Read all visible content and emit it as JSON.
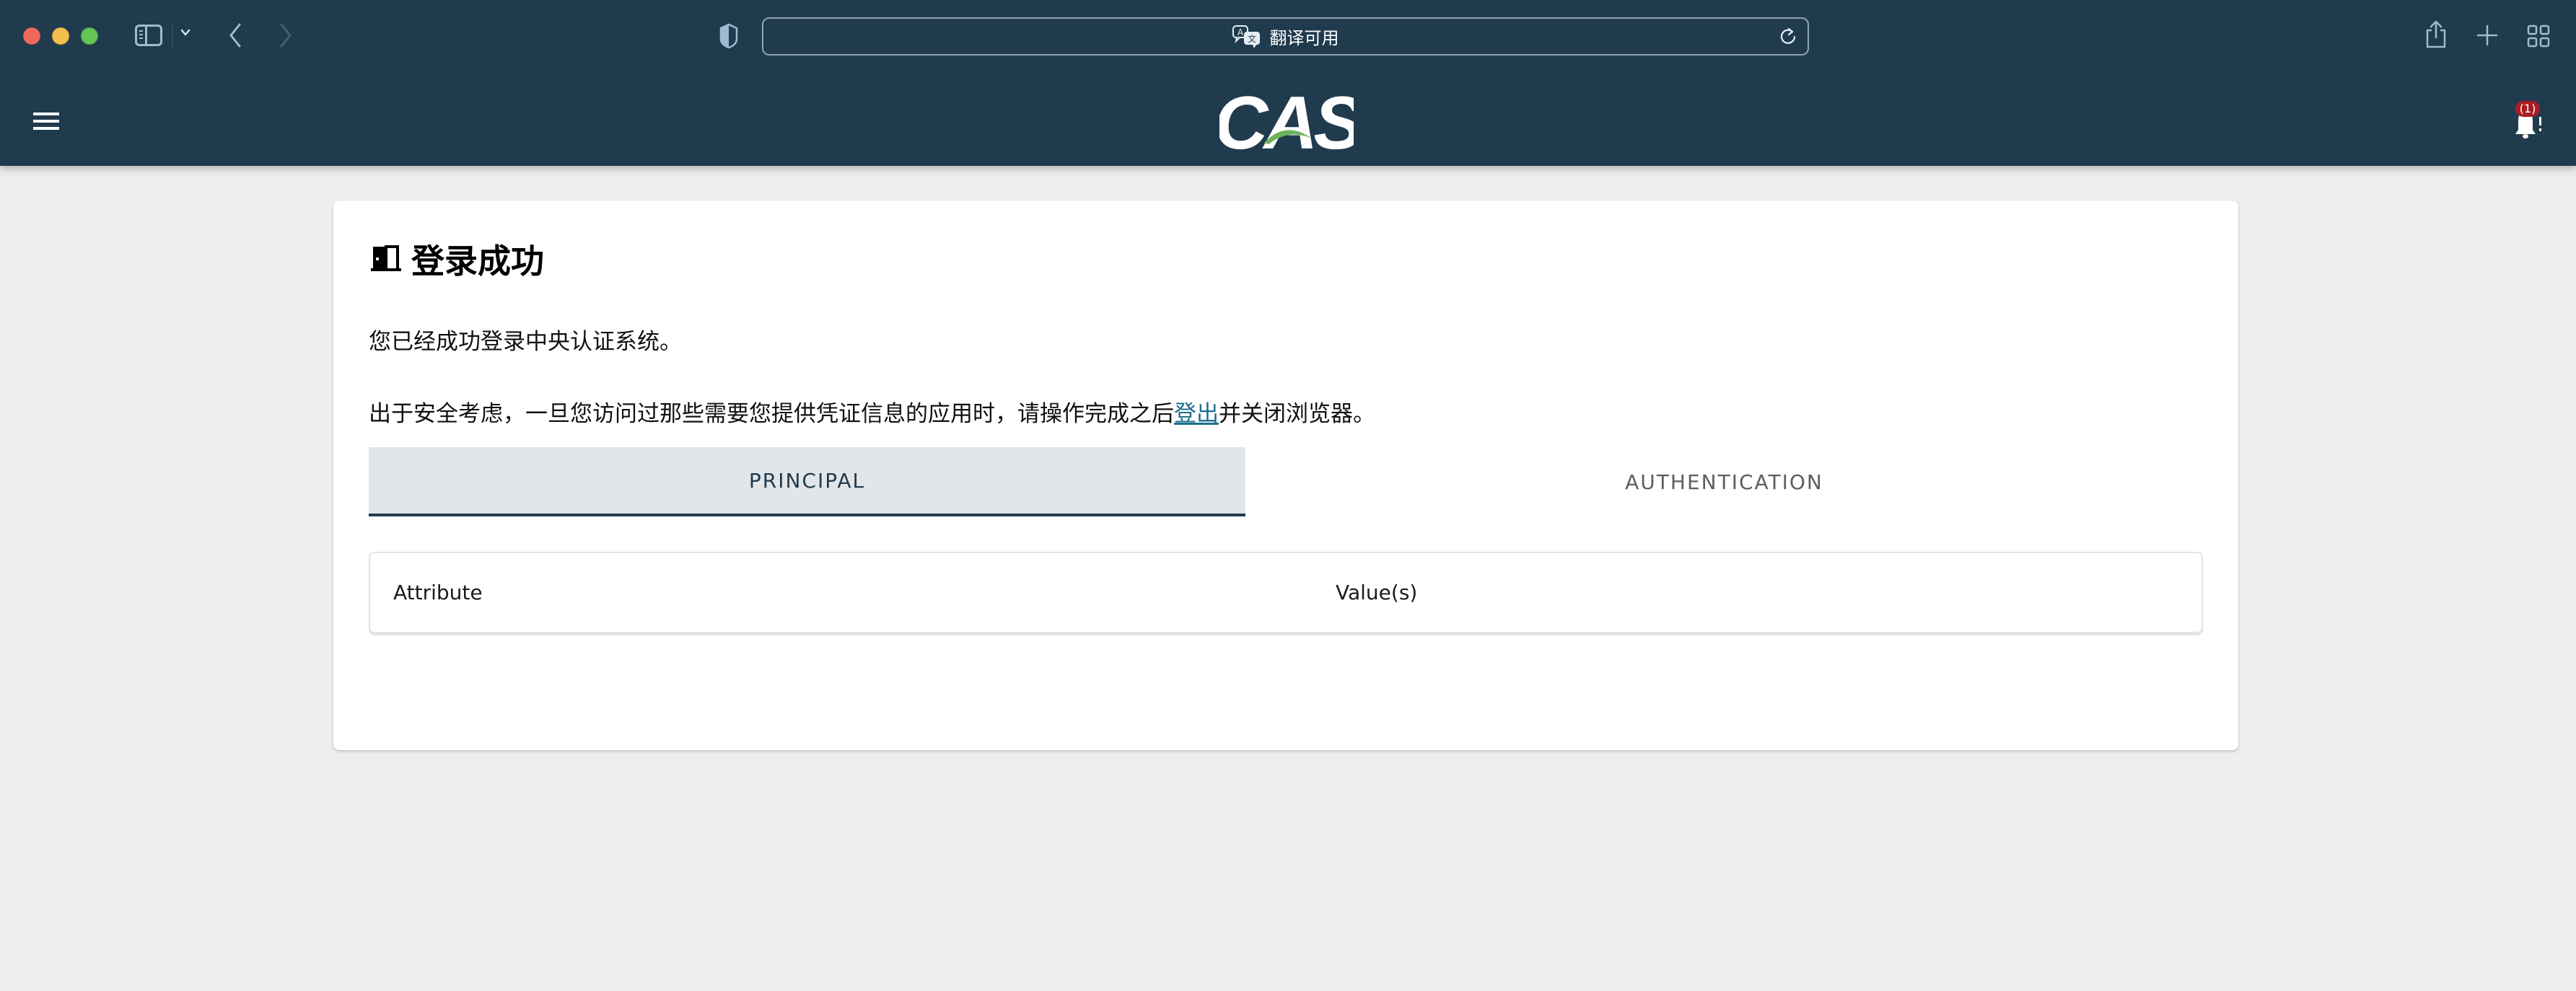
{
  "browser": {
    "address_text": "翻译可用",
    "icons": {
      "close": "traffic-light-red",
      "minimize": "traffic-light-yellow",
      "zoom": "traffic-light-green",
      "sidebar": "sidebar-icon",
      "tab_group_menu": "chevron-down-icon",
      "back": "chevron-left-icon",
      "forward": "chevron-right-icon",
      "privacy": "shield-icon",
      "translate": "translate-icon",
      "reload": "reload-icon",
      "share": "share-icon",
      "new_tab": "plus-icon",
      "tab_overview": "grid-icon"
    }
  },
  "header": {
    "logo_text": "CAS",
    "menu_icon": "hamburger-icon",
    "notifications": {
      "icon": "bell-icon",
      "badge": "(1)"
    },
    "colors": {
      "background": "#213b4e",
      "logo_accent": "#6cb35a",
      "badge": "#a81d24"
    }
  },
  "card": {
    "title_icon": "door-icon",
    "title": "登录成功",
    "message": "您已经成功登录中央认证系统。",
    "security_note": {
      "before_link": "出于安全考虑，一旦您访问过那些需要您提供凭证信息的应用时，请操作完成之后",
      "link": "登出",
      "after_link": "并关闭浏览器。"
    },
    "tabs": [
      {
        "label": "PRINCIPAL",
        "active": true
      },
      {
        "label": "AUTHENTICATION",
        "active": false
      }
    ],
    "table": {
      "columns": [
        "Attribute",
        "Value(s)"
      ],
      "rows": []
    }
  }
}
